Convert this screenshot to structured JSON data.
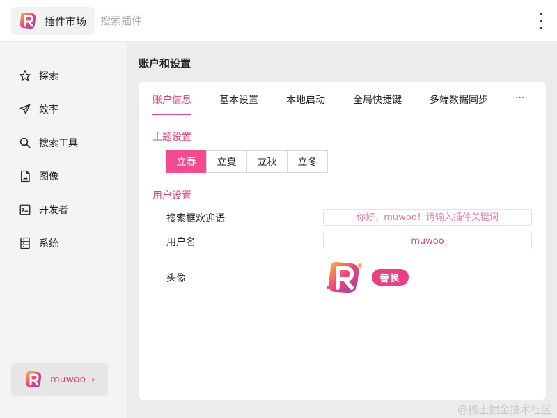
{
  "app": {
    "title": "插件市场",
    "search_placeholder": "搜索插件",
    "more_icon": "more-vert-icon"
  },
  "sidebar": {
    "items": [
      {
        "label": "探索",
        "icon": "star-icon"
      },
      {
        "label": "效率",
        "icon": "send-icon"
      },
      {
        "label": "搜索工具",
        "icon": "search-icon"
      },
      {
        "label": "图像",
        "icon": "image-file-icon"
      },
      {
        "label": "开发者",
        "icon": "terminal-icon"
      },
      {
        "label": "系统",
        "icon": "server-icon"
      }
    ],
    "user": {
      "name": "muwoo",
      "chevron": "›"
    }
  },
  "main": {
    "page_title": "账户和设置",
    "tabs": [
      {
        "label": "账户信息",
        "active": true
      },
      {
        "label": "基本设置",
        "active": false
      },
      {
        "label": "本地启动",
        "active": false
      },
      {
        "label": "全局快捷键",
        "active": false
      },
      {
        "label": "多端数据同步",
        "active": false
      },
      {
        "label": "···",
        "active": false
      }
    ],
    "theme_section": "主题设置",
    "themes": [
      {
        "label": "立春",
        "active": true
      },
      {
        "label": "立夏",
        "active": false
      },
      {
        "label": "立秋",
        "active": false
      },
      {
        "label": "立冬",
        "active": false
      }
    ],
    "user_section": "用户设置",
    "fields": {
      "greeting_label": "搜索框欢迎语",
      "greeting_placeholder": "你好，muwoo！请输入插件关键词",
      "username_label": "用户名",
      "username_value": "muwoo",
      "avatar_label": "头像",
      "replace_button": "替换"
    }
  },
  "watermark": "@稀土掘金技术社区",
  "colors": {
    "accent": "#e0457b",
    "accent_button": "#f24c8f",
    "sidebar_bg": "#f4f4f4",
    "main_bg": "#ececec"
  }
}
